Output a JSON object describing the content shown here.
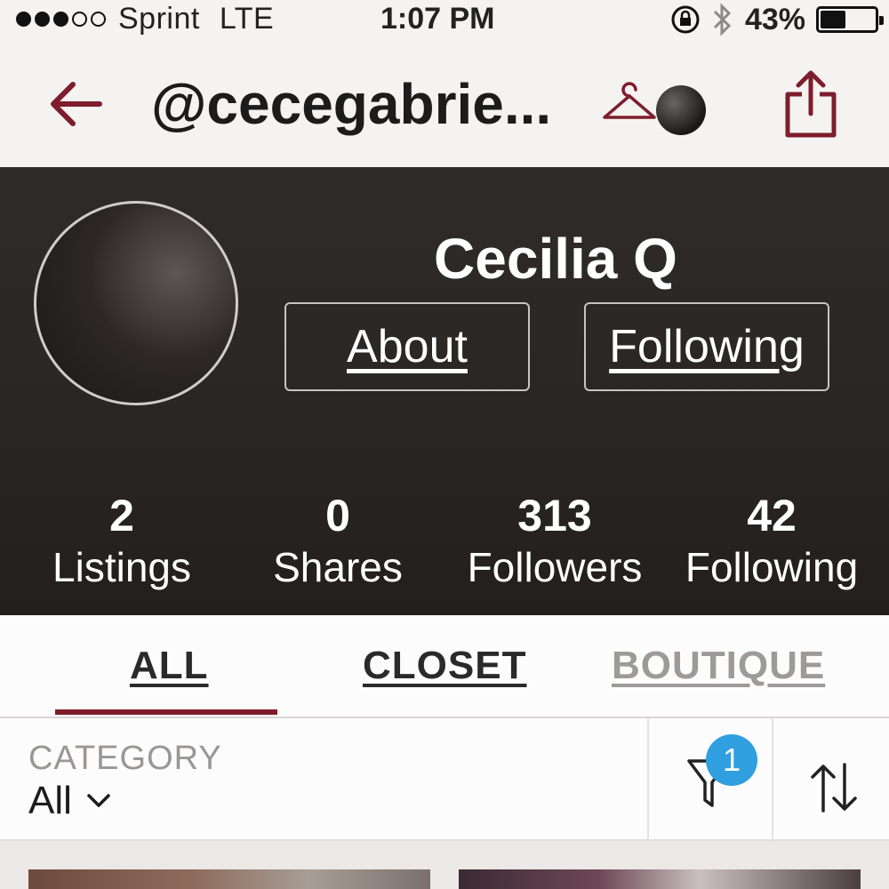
{
  "status_bar": {
    "carrier": "Sprint",
    "network": "LTE",
    "time": "1:07 PM",
    "battery_percent": "43%",
    "battery_level": 0.43,
    "signal_bars_filled": 3,
    "signal_bars_total": 5
  },
  "nav": {
    "handle": "@cecegabrie...",
    "back_icon": "arrow-left-icon",
    "hanger_icon": "hanger-icon",
    "share_icon": "share-icon"
  },
  "profile": {
    "name": "Cecilia Q",
    "about_label": "About",
    "following_label": "Following"
  },
  "stats": [
    {
      "value": "2",
      "label": "Listings"
    },
    {
      "value": "0",
      "label": "Shares"
    },
    {
      "value": "313",
      "label": "Followers"
    },
    {
      "value": "42",
      "label": "Following"
    }
  ],
  "tabs": [
    {
      "label": "ALL",
      "active": true
    },
    {
      "label": "CLOSET",
      "active": false
    },
    {
      "label": "BOUTIQUE",
      "active": false
    }
  ],
  "filter_bar": {
    "category_label": "CATEGORY",
    "category_value": "All",
    "filter_badge": "1"
  },
  "colors": {
    "accent": "#7e1e2d",
    "badge": "#2f9fe0",
    "header_bg": "#2a2625"
  }
}
